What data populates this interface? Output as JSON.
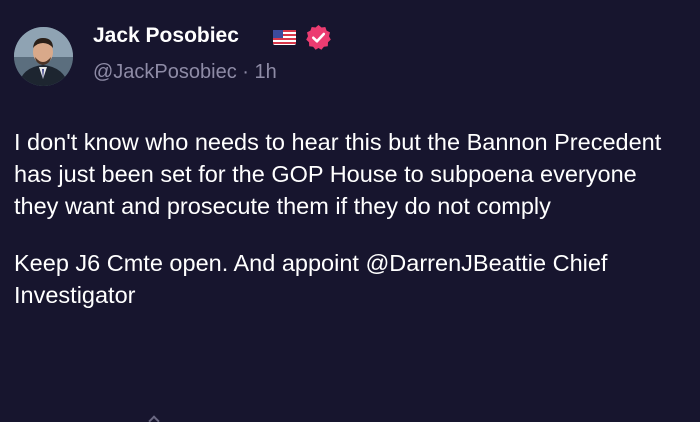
{
  "author": {
    "name": "Jack Posobiec",
    "handle": "@JackPosobiec",
    "separator": "·",
    "time": "1h",
    "flag_icon": "us-flag-icon",
    "verified_icon": "verified-badge-icon",
    "verified_color": "#ec3c71"
  },
  "post": {
    "paragraph1": "I don't know who needs to hear this but the Bannon Precedent has just been set for the GOP House to subpoena everyone they want and prosecute them if they do not comply",
    "paragraph2_before": "Keep J6 Cmte open. And appoint ",
    "paragraph2_mention": "@DarrenJBeattie",
    "paragraph2_after": " Chief Investigator"
  },
  "colors": {
    "background": "#17152e",
    "text": "#ffffff",
    "muted": "#8e8ba6"
  }
}
